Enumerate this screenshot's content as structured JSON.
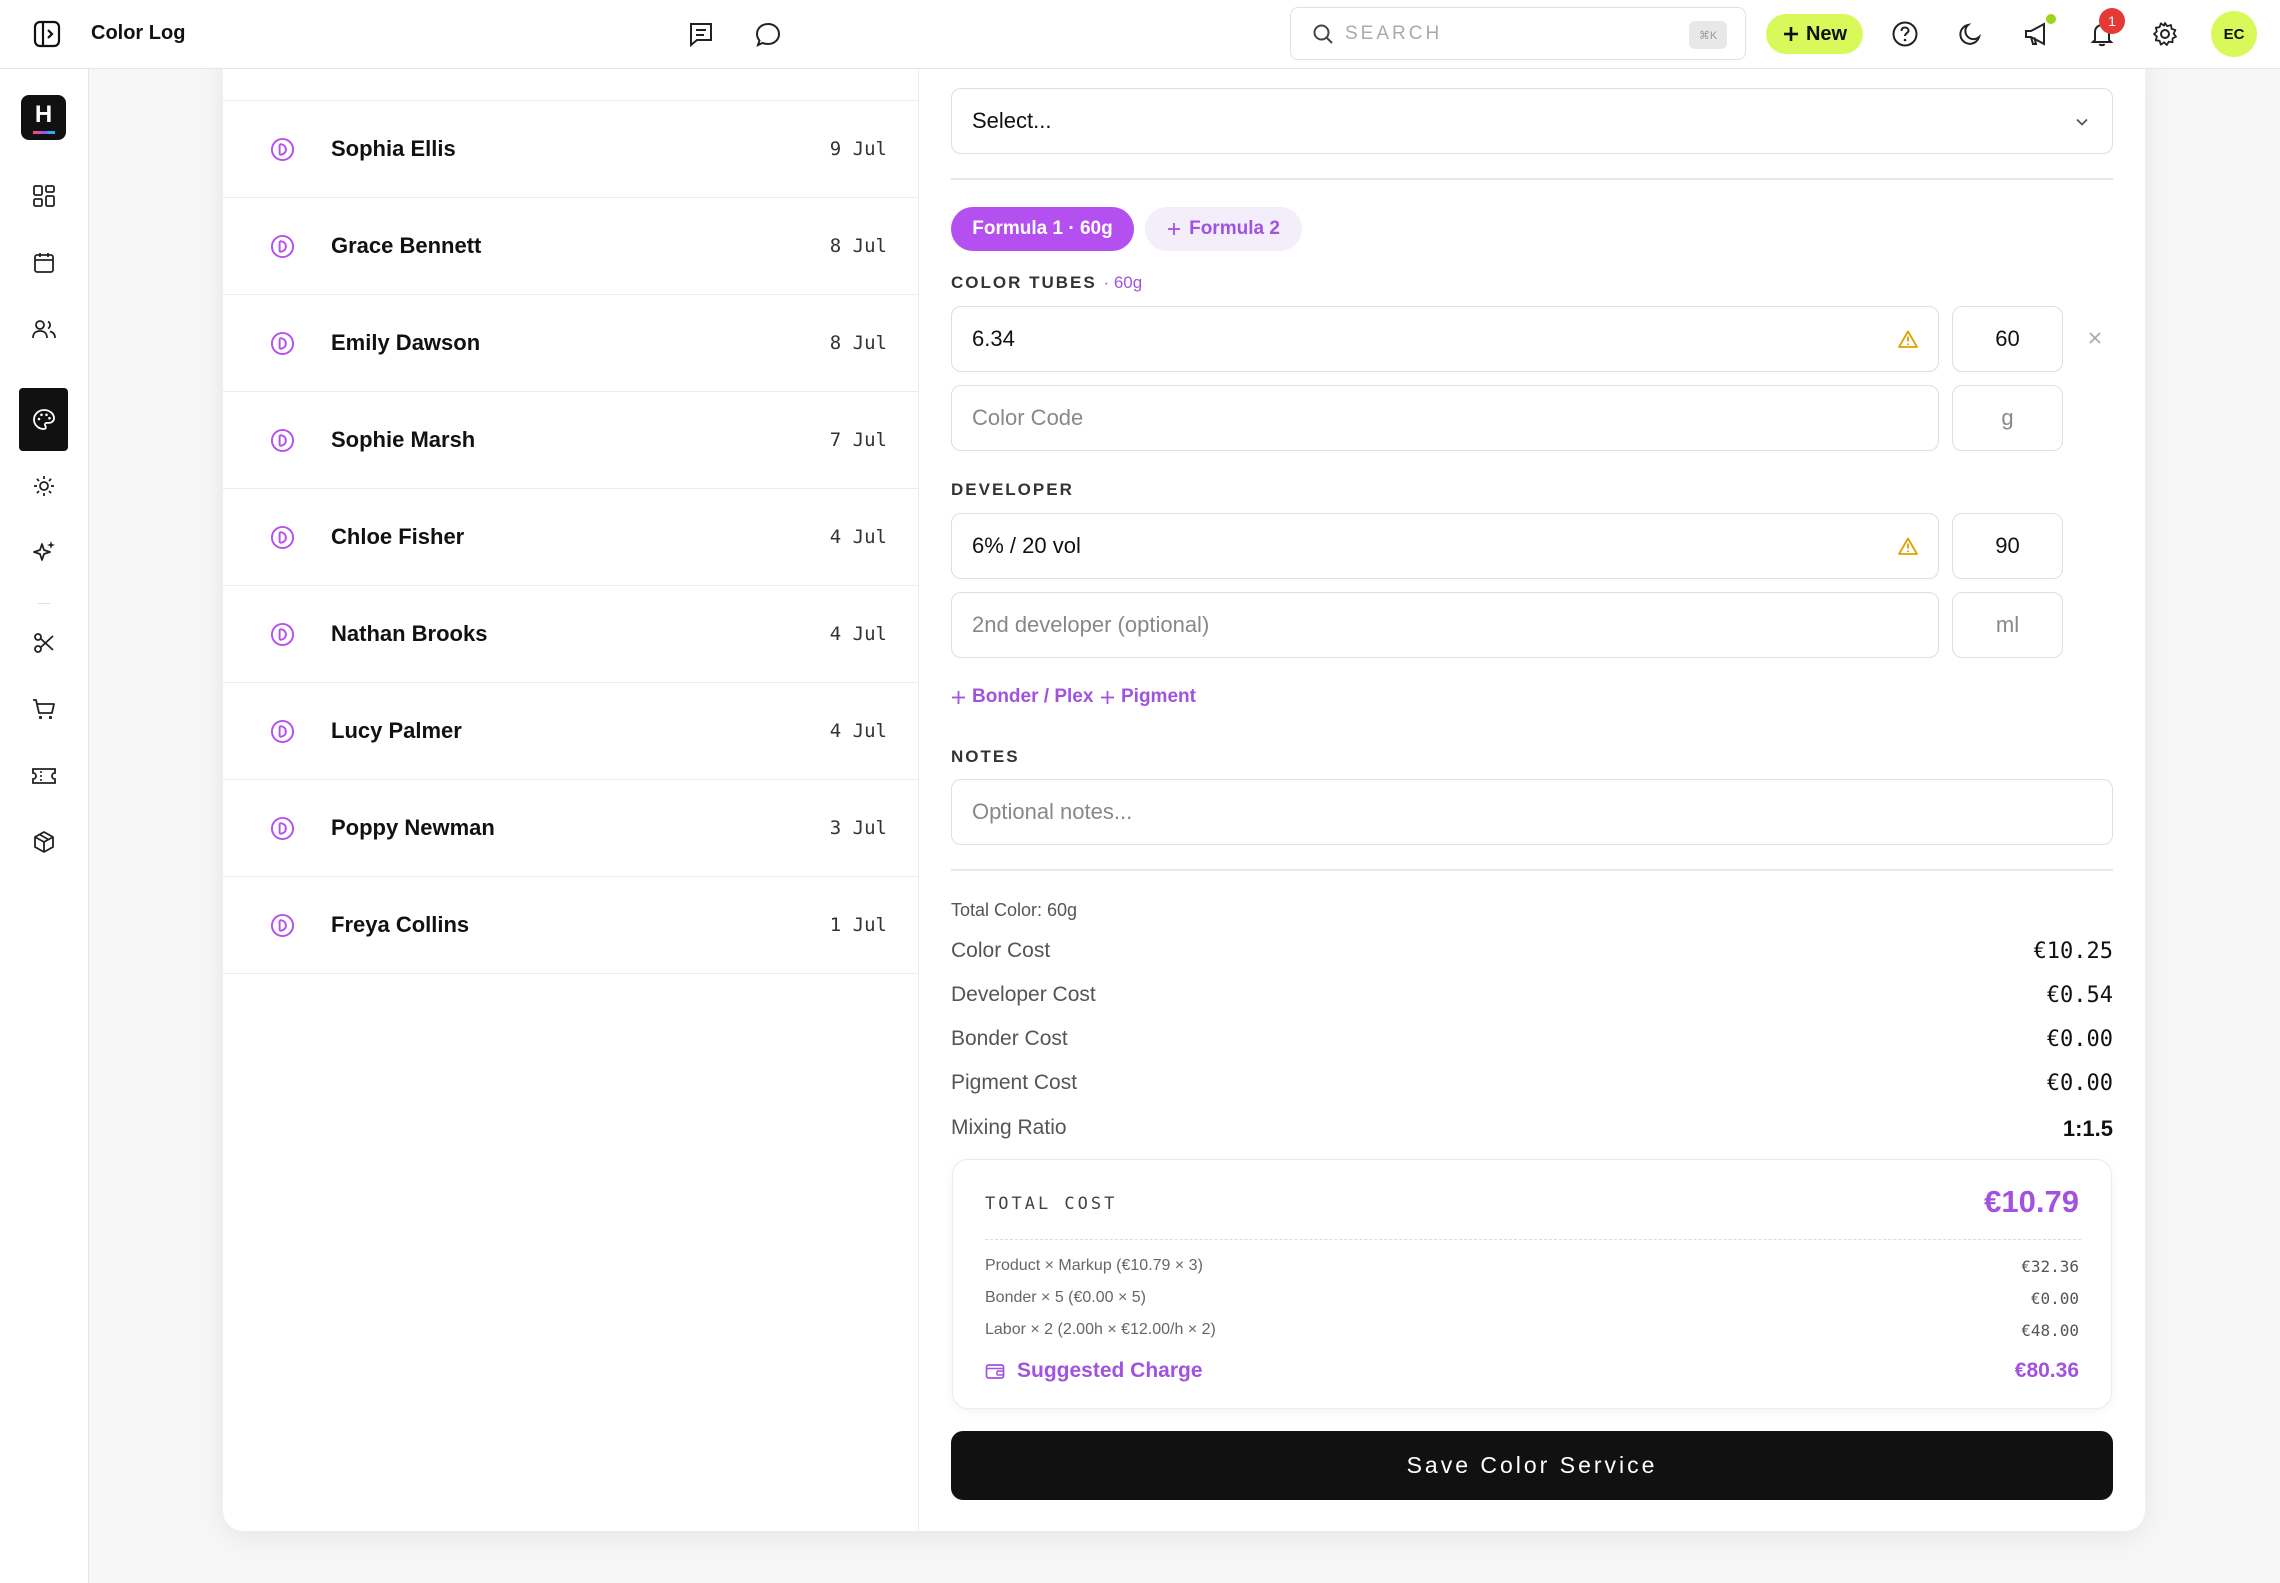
{
  "app": {
    "title": "Color Log"
  },
  "search": {
    "placeholder": "SEARCH",
    "shortcut": "⌘K"
  },
  "header": {
    "new_label": "New",
    "notifications_count": "1",
    "user_initials": "EC"
  },
  "clients": [
    {
      "name": "Sophia Ellis",
      "date": "9 Jul"
    },
    {
      "name": "Grace Bennett",
      "date": "8 Jul"
    },
    {
      "name": "Emily Dawson",
      "date": "8 Jul"
    },
    {
      "name": "Sophie Marsh",
      "date": "7 Jul"
    },
    {
      "name": "Chloe Fisher",
      "date": "4 Jul"
    },
    {
      "name": "Nathan Brooks",
      "date": "4 Jul"
    },
    {
      "name": "Lucy Palmer",
      "date": "4 Jul"
    },
    {
      "name": "Poppy Newman",
      "date": "3 Jul"
    },
    {
      "name": "Freya Collins",
      "date": "1 Jul"
    }
  ],
  "form": {
    "stylist_select": "Select...",
    "formula_tabs": {
      "active": "Formula 1 · 60g",
      "add": "Formula 2"
    },
    "color_tubes": {
      "label": "COLOR TUBES",
      "suffix": "· 60g",
      "tube_value": "6.34",
      "tube_amount": "60",
      "code_placeholder": "Color Code",
      "unit_placeholder": "g"
    },
    "developer": {
      "label": "DEVELOPER",
      "value": "6% / 20 vol",
      "amount": "90",
      "second_placeholder": "2nd developer (optional)",
      "unit_placeholder": "ml"
    },
    "add_links": {
      "bonder": "Bonder / Plex",
      "pigment": "Pigment"
    },
    "notes": {
      "label": "NOTES",
      "placeholder": "Optional notes..."
    }
  },
  "summary": {
    "total_color": "Total Color: 60g",
    "rows": [
      {
        "label": "Color Cost",
        "value": "€10.25"
      },
      {
        "label": "Developer Cost",
        "value": "€0.54"
      },
      {
        "label": "Bonder Cost",
        "value": "€0.00"
      },
      {
        "label": "Pigment Cost",
        "value": "€0.00"
      }
    ],
    "mixing_ratio": {
      "label": "Mixing Ratio",
      "value": "1:1.5"
    }
  },
  "total": {
    "label": "TOTAL COST",
    "value": "€10.79",
    "breakdown": [
      {
        "label": "Product × Markup (€10.79 × 3)",
        "value": "€32.36"
      },
      {
        "label": "Bonder × 5 (€0.00 × 5)",
        "value": "€0.00"
      },
      {
        "label": "Labor × 2 (2.00h × €12.00/h × 2)",
        "value": "€48.00"
      }
    ],
    "suggested_label": "Suggested Charge",
    "suggested_value": "€80.36"
  },
  "save_label": "Save Color Service",
  "colors": {
    "accent_purple": "#b44ff0",
    "accent_lime": "#d9f95a",
    "warning": "#e0a100"
  }
}
